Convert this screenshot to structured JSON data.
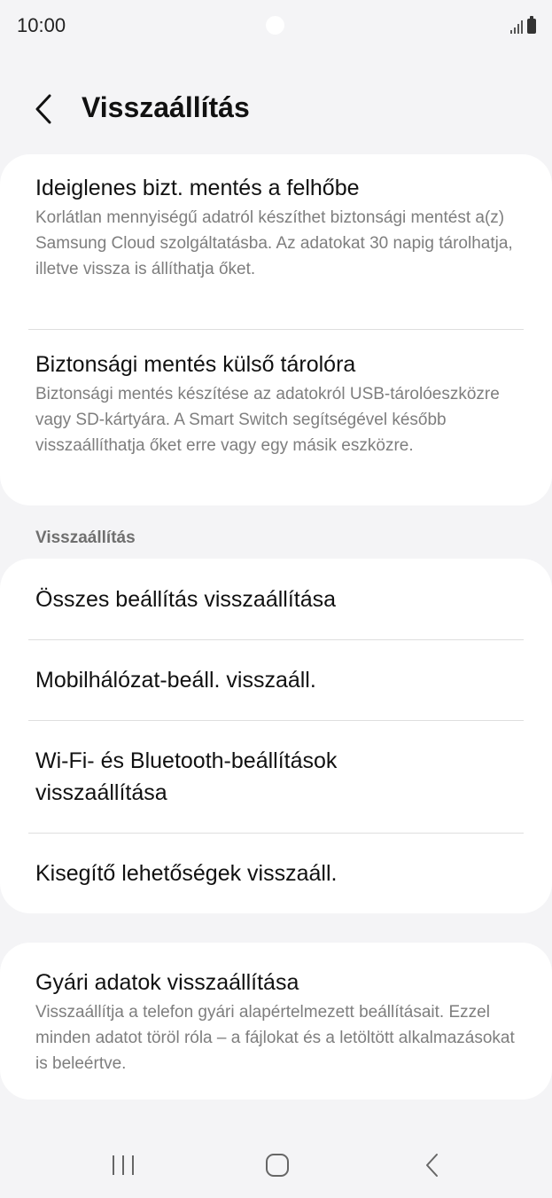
{
  "status_bar": {
    "time": "10:00",
    "icons": [
      "signal-icon",
      "battery-icon"
    ]
  },
  "header": {
    "title": "Visszaállítás",
    "back_icon": "chevron-left-icon"
  },
  "backup_card": {
    "items": [
      {
        "title": "Ideiglenes bizt. mentés a felhőbe",
        "description": "Korlátlan mennyiségű adatról készíthet biztonsági mentést a(z) Samsung Cloud szolgáltatásba. Az adatokat 30 napig tárolhatja, illetve vissza is állíthatja őket."
      },
      {
        "title": "Biztonsági mentés külső tárolóra",
        "description": "Biztonsági mentés készítése az adatokról USB-tárolóeszközre vagy SD-kártyára. A Smart Switch segítségével később visszaállíthatja őket erre vagy egy másik eszközre."
      }
    ]
  },
  "reset_section": {
    "label": "Visszaállítás",
    "items": [
      {
        "title": "Összes beállítás visszaállítása"
      },
      {
        "title": "Mobilhálózat-beáll. visszaáll."
      },
      {
        "title": "Wi-Fi- és Bluetooth-beállítások visszaállítása"
      },
      {
        "title": "Kisegítő lehetőségek visszaáll."
      }
    ]
  },
  "factory_card": {
    "title": "Gyári adatok visszaállítása",
    "description": "Visszaállítja a telefon gyári alapértelmezett beállításait. Ezzel minden adatot töröl róla – a fájlokat és a letöltött alkalmazásokat is beleértve."
  },
  "nav_bar": {
    "icons": [
      "recents-icon",
      "home-icon",
      "back-icon"
    ]
  },
  "colors": {
    "background": "#f4f4f6",
    "card": "#ffffff",
    "text_primary": "#111111",
    "text_secondary": "#7e7e7e",
    "divider": "#dedede"
  }
}
